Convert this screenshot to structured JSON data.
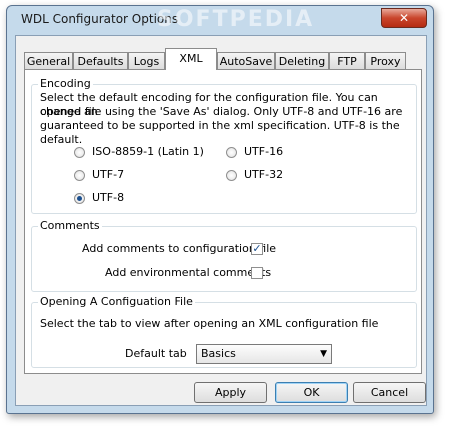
{
  "window": {
    "title": "WDL Configurator Options",
    "watermark": "SOFTPEDIA",
    "close_glyph": "✕"
  },
  "tabs": [
    {
      "label": "General"
    },
    {
      "label": "Defaults"
    },
    {
      "label": "Logs"
    },
    {
      "label": "XML"
    },
    {
      "label": "AutoSave"
    },
    {
      "label": "Deleting"
    },
    {
      "label": "FTP"
    },
    {
      "label": "Proxy"
    }
  ],
  "active_tab": "XML",
  "encoding": {
    "legend": "Encoding",
    "description_lines": [
      "Select the default encoding for the configuration file. You can change an",
      "opened file using the 'Save As' dialog. Only UTF-8 and UTF-16 are",
      "guaranteed to be supported in the xml specification. UTF-8 is the default."
    ],
    "options": [
      {
        "label": "ISO-8859-1 (Latin 1)",
        "selected": false
      },
      {
        "label": "UTF-16",
        "selected": false
      },
      {
        "label": "UTF-7",
        "selected": false
      },
      {
        "label": "UTF-32",
        "selected": false
      },
      {
        "label": "UTF-8",
        "selected": true
      }
    ]
  },
  "comments": {
    "legend": "Comments",
    "add_comments": {
      "label": "Add comments to configuration file",
      "checked": true
    },
    "add_env_comments": {
      "label": "Add environmental comments",
      "checked": false
    }
  },
  "opening": {
    "legend": "Opening A Configuation File",
    "description": "Select the tab to view after opening an XML configuration file",
    "default_tab_label": "Default tab",
    "default_tab_value": "Basics"
  },
  "buttons": {
    "apply": "Apply",
    "ok": "OK",
    "cancel": "Cancel"
  },
  "glyphs": {
    "check": "✓",
    "dropdown_arrow": "▼"
  }
}
